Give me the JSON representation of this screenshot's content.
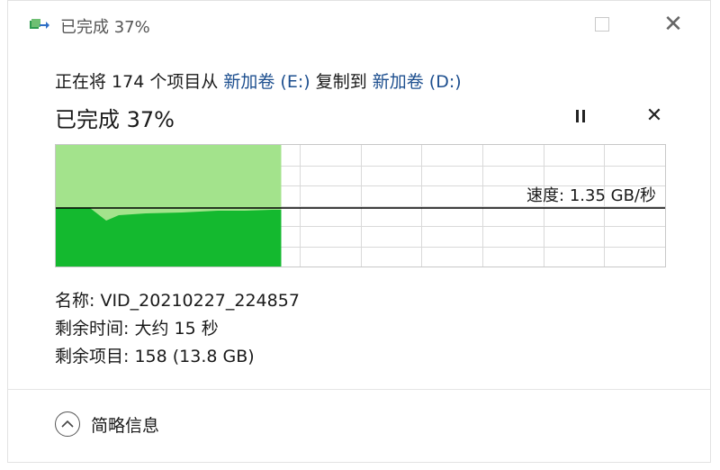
{
  "window": {
    "title": "已完成 37%",
    "icons": {
      "app": "copy-files-icon",
      "maximize": "maximize-icon",
      "close": "close-icon"
    }
  },
  "copy": {
    "prefix": "正在将 174 个项目从 ",
    "source": "新加卷 (E:)",
    "middle": " 复制到 ",
    "destination": "新加卷 (D:)"
  },
  "progress": {
    "title": "已完成 37%",
    "percent": 37,
    "pause_icon": "pause-icon",
    "cancel_icon": "cancel-icon",
    "cancel_glyph": "✕"
  },
  "graph": {
    "speed_label": "速度: 1.35 GB/秒",
    "colors": {
      "light_fill": "#a3e38c",
      "dark_fill": "#14b92f",
      "grid": "#d9d9d9",
      "speed_line": "#000000"
    }
  },
  "info": {
    "name": "名称: VID_20210227_224857",
    "time_remaining": "剩余时间: 大约 15 秒",
    "items_remaining": "剩余项目: 158 (13.8 GB)"
  },
  "details": {
    "label": "简略信息",
    "icon": "chevron-up-icon"
  }
}
